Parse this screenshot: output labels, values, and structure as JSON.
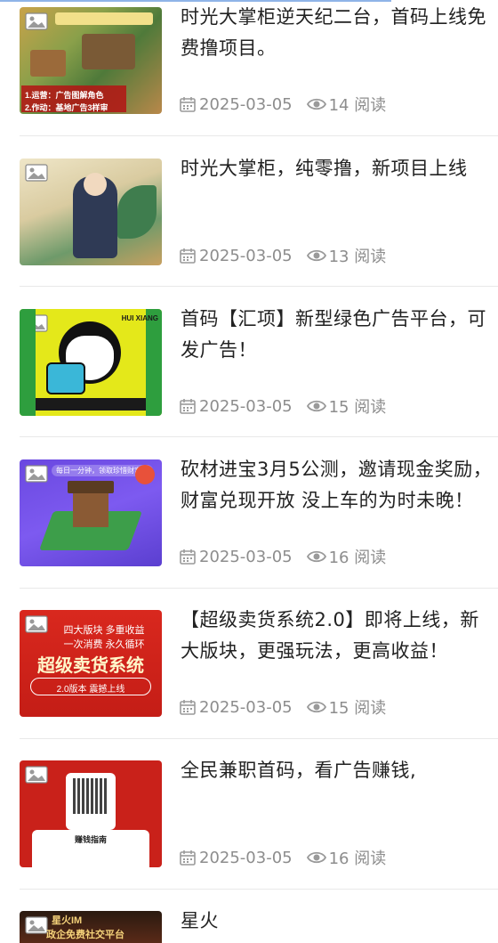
{
  "articles": [
    {
      "title": "时光大掌柜逆天纪二台，首码上线免费撸项目。",
      "date": "2025-03-05",
      "reads": "14 阅读",
      "thumb_text": [
        "1.运营：广告图解角色",
        "2.作动：基地广告3样审"
      ],
      "thumb_icon": "image-placeholder-icon"
    },
    {
      "title": "时光大掌柜，纯零撸，新项目上线",
      "date": "2025-03-05",
      "reads": "13 阅读",
      "thumb_icon": "image-placeholder-icon"
    },
    {
      "title": "首码【汇项】新型绿色广告平台，可发广告！",
      "date": "2025-03-05",
      "reads": "15 阅读",
      "thumb_text": [
        "HUI XIANG"
      ],
      "thumb_icon": "image-placeholder-icon"
    },
    {
      "title": "砍材进宝3月5公测，邀请现金奖励，财富兑现开放 没上车的为时未晚！",
      "date": "2025-03-05",
      "reads": "16 阅读",
      "thumb_text": [
        "每日一分钟，领取珍惜财富值"
      ],
      "thumb_icon": "image-placeholder-icon"
    },
    {
      "title": "【超级卖货系统2.0】即将上线，新大版块，更强玩法，更高收益！",
      "date": "2025-03-05",
      "reads": "15 阅读",
      "thumb_text": [
        "四大版块 多重收益",
        "一次消费 永久循环",
        "超级卖货系统",
        "2.0版本 震撼上线"
      ],
      "thumb_icon": "image-placeholder-icon"
    },
    {
      "title": "全民兼职首码，看广告赚钱,",
      "date": "2025-03-05",
      "reads": "16 阅读",
      "thumb_text": [
        "赚钱指南"
      ],
      "thumb_icon": "image-placeholder-icon"
    },
    {
      "title": "星火",
      "thumb_text": [
        "星火IM",
        "政企免费社交平台"
      ],
      "thumb_icon": "image-placeholder-icon"
    }
  ],
  "meta_icons": {
    "date": "calendar-icon",
    "reads": "eye-icon"
  },
  "colors": {
    "text": "#222222",
    "meta": "#8d8d8d",
    "divider": "#e9e9e9"
  }
}
